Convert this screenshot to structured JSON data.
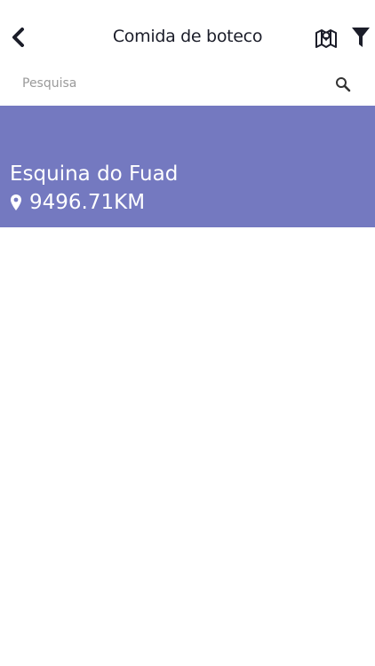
{
  "header": {
    "title": "Comida de boteco",
    "back_icon": "chevron-left-icon",
    "map_icon": "map-icon",
    "filter_icon": "filter-icon"
  },
  "search": {
    "placeholder": "Pesquisa",
    "value": "",
    "icon": "search-icon"
  },
  "results": [
    {
      "name": "Esquina do Fuad",
      "distance": "9496.71KM",
      "pin_icon": "location-pin-icon",
      "background_color": "#7479c0"
    }
  ],
  "colors": {
    "accent": "#7479c0",
    "text_dark": "#1b1d29",
    "placeholder": "#9a9a9a"
  }
}
